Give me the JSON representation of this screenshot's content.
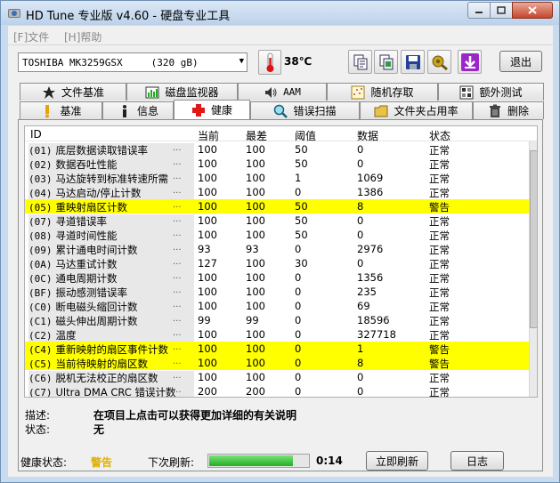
{
  "window": {
    "title": "HD Tune 专业版 v4.60 - 硬盘专业工具"
  },
  "menu": {
    "file": "[F]文件",
    "help": "[H]帮助"
  },
  "toolbar": {
    "drive": "TOSHIBA MK3259GSX",
    "drive_size": "(320 gB)",
    "temperature": "38℃",
    "exit_label": "退出",
    "icons": [
      "copy-text-icon",
      "copy-screen-icon",
      "save-icon",
      "options-icon",
      "download-icon"
    ]
  },
  "tabs_row1": [
    {
      "label": "文件基准",
      "icon": "file-benchmark-icon"
    },
    {
      "label": "磁盘监视器",
      "icon": "disk-monitor-icon"
    },
    {
      "label": "AAM",
      "icon": "speaker-icon"
    },
    {
      "label": "随机存取",
      "icon": "random-access-icon"
    },
    {
      "label": "额外测试",
      "icon": "extra-tests-icon"
    }
  ],
  "tabs_row2": [
    {
      "label": "基准",
      "icon": "benchmark-icon"
    },
    {
      "label": "信息",
      "icon": "info-icon"
    },
    {
      "label": "健康",
      "icon": "health-cross-icon",
      "active": true
    },
    {
      "label": "错误扫描",
      "icon": "error-scan-icon"
    },
    {
      "label": "文件夹占用率",
      "icon": "folder-usage-icon"
    },
    {
      "label": "删除",
      "icon": "erase-icon"
    }
  ],
  "table": {
    "headers": [
      "ID",
      "当前",
      "最差",
      "阈值",
      "数据",
      "状态"
    ],
    "rows": [
      {
        "id": "(01)",
        "name": "底层数据读取错误率",
        "current": "100",
        "worst": "100",
        "threshold": "50",
        "data": "0",
        "status": "正常",
        "warn": false
      },
      {
        "id": "(02)",
        "name": "数据吞吐性能",
        "current": "100",
        "worst": "100",
        "threshold": "50",
        "data": "0",
        "status": "正常",
        "warn": false
      },
      {
        "id": "(03)",
        "name": "马达旋转到标准转速所需",
        "current": "100",
        "worst": "100",
        "threshold": "1",
        "data": "1069",
        "status": "正常",
        "warn": false
      },
      {
        "id": "(04)",
        "name": "马达启动/停止计数",
        "current": "100",
        "worst": "100",
        "threshold": "0",
        "data": "1386",
        "status": "正常",
        "warn": false
      },
      {
        "id": "(05)",
        "name": "重映射扇区计数",
        "current": "100",
        "worst": "100",
        "threshold": "50",
        "data": "8",
        "status": "警告",
        "warn": true
      },
      {
        "id": "(07)",
        "name": "寻道错误率",
        "current": "100",
        "worst": "100",
        "threshold": "50",
        "data": "0",
        "status": "正常",
        "warn": false
      },
      {
        "id": "(08)",
        "name": "寻道时间性能",
        "current": "100",
        "worst": "100",
        "threshold": "50",
        "data": "0",
        "status": "正常",
        "warn": false
      },
      {
        "id": "(09)",
        "name": "累计通电时间计数",
        "current": "93",
        "worst": "93",
        "threshold": "0",
        "data": "2976",
        "status": "正常",
        "warn": false
      },
      {
        "id": "(0A)",
        "name": "马达重试计数",
        "current": "127",
        "worst": "100",
        "threshold": "30",
        "data": "0",
        "status": "正常",
        "warn": false
      },
      {
        "id": "(0C)",
        "name": "通电周期计数",
        "current": "100",
        "worst": "100",
        "threshold": "0",
        "data": "1356",
        "status": "正常",
        "warn": false
      },
      {
        "id": "(BF)",
        "name": "振动感测错误率",
        "current": "100",
        "worst": "100",
        "threshold": "0",
        "data": "235",
        "status": "正常",
        "warn": false
      },
      {
        "id": "(C0)",
        "name": "断电磁头缩回计数",
        "current": "100",
        "worst": "100",
        "threshold": "0",
        "data": "69",
        "status": "正常",
        "warn": false
      },
      {
        "id": "(C1)",
        "name": "磁头伸出周期计数",
        "current": "99",
        "worst": "99",
        "threshold": "0",
        "data": "18596",
        "status": "正常",
        "warn": false
      },
      {
        "id": "(C2)",
        "name": "温度",
        "current": "100",
        "worst": "100",
        "threshold": "0",
        "data": "327718",
        "status": "正常",
        "warn": false
      },
      {
        "id": "(C4)",
        "name": "重新映射的扇区事件计数",
        "current": "100",
        "worst": "100",
        "threshold": "0",
        "data": "1",
        "status": "警告",
        "warn": true
      },
      {
        "id": "(C5)",
        "name": "当前待映射的扇区数",
        "current": "100",
        "worst": "100",
        "threshold": "0",
        "data": "8",
        "status": "警告",
        "warn": true
      },
      {
        "id": "(C6)",
        "name": "脱机无法校正的扇区数",
        "current": "100",
        "worst": "100",
        "threshold": "0",
        "data": "0",
        "status": "正常",
        "warn": false
      },
      {
        "id": "(C7)",
        "name": "Ultra DMA CRC 错误计数",
        "current": "200",
        "worst": "200",
        "threshold": "0",
        "data": "0",
        "status": "正常",
        "warn": false
      }
    ],
    "dots": "..."
  },
  "details": {
    "desc_label": "描述:",
    "desc_text": "在项目上点击可以获得更加详细的有关说明",
    "status_label": "状态:",
    "status_text": "无"
  },
  "footer": {
    "health_label": "健康状态:",
    "health_value": "警告",
    "health_color": "#e0b000",
    "next_refresh_label": "下次刷新:",
    "refresh_progress": 0.85,
    "refresh_time": "0:14",
    "refresh_button": "立即刷新",
    "log_button": "日志"
  },
  "colors": {
    "warn_row": "#ffff00",
    "accent": "#c9dcef"
  }
}
